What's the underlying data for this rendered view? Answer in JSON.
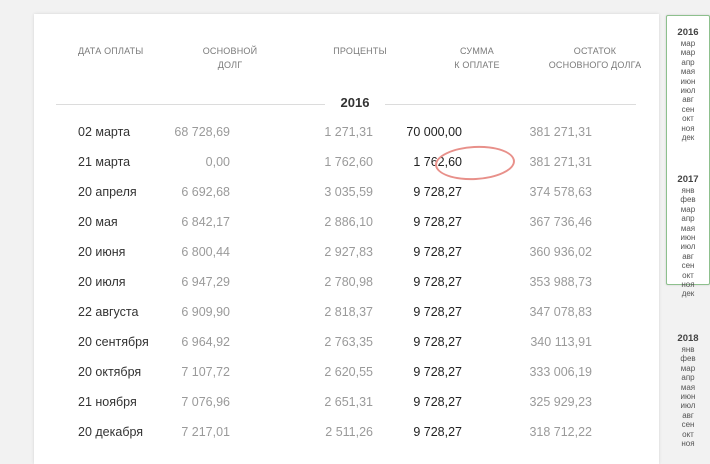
{
  "headers": {
    "date": [
      "ДАТА ОПЛАТЫ"
    ],
    "principal": [
      "ОСНОВНОЙ",
      "ДОЛГ"
    ],
    "interest": [
      "ПРОЦЕНТЫ"
    ],
    "total": [
      "СУММА",
      "К ОПЛАТЕ"
    ],
    "balance": [
      "ОСТАТОК",
      "ОСНОВНОГО ДОЛГА"
    ]
  },
  "year_label": "2016",
  "rows": [
    {
      "date": "02 марта",
      "principal": "68 728,69",
      "interest": "1 271,31",
      "total": "70 000,00",
      "balance": "381 271,31"
    },
    {
      "date": "21 марта",
      "principal": "0,00",
      "interest": "1 762,60",
      "total": "1 762,60",
      "balance": "381 271,31"
    },
    {
      "date": "20 апреля",
      "principal": "6 692,68",
      "interest": "3 035,59",
      "total": "9 728,27",
      "balance": "374 578,63"
    },
    {
      "date": "20 мая",
      "principal": "6 842,17",
      "interest": "2 886,10",
      "total": "9 728,27",
      "balance": "367 736,46"
    },
    {
      "date": "20 июня",
      "principal": "6 800,44",
      "interest": "2 927,83",
      "total": "9 728,27",
      "balance": "360 936,02"
    },
    {
      "date": "20 июля",
      "principal": "6 947,29",
      "interest": "2 780,98",
      "total": "9 728,27",
      "balance": "353 988,73"
    },
    {
      "date": "22 августа",
      "principal": "6 909,90",
      "interest": "2 818,37",
      "total": "9 728,27",
      "balance": "347 078,83"
    },
    {
      "date": "20 сентября",
      "principal": "6 964,92",
      "interest": "2 763,35",
      "total": "9 728,27",
      "balance": "340 113,91"
    },
    {
      "date": "20 октября",
      "principal": "7 107,72",
      "interest": "2 620,55",
      "total": "9 728,27",
      "balance": "333 006,19"
    },
    {
      "date": "21 ноября",
      "principal": "7 076,96",
      "interest": "2 651,31",
      "total": "9 728,27",
      "balance": "325 929,23"
    },
    {
      "date": "20 декабря",
      "principal": "7 217,01",
      "interest": "2 511,26",
      "total": "9 728,27",
      "balance": "318 712,22"
    }
  ],
  "sidebar": {
    "years": [
      {
        "year": "2016",
        "months": [
          "мар",
          "мар",
          "апр",
          "мая",
          "июн",
          "июл",
          "авг",
          "сен",
          "окт",
          "ноя",
          "дек"
        ]
      },
      {
        "year": "2017",
        "months": [
          "янв",
          "фев",
          "мар",
          "апр",
          "мая",
          "июн",
          "июл",
          "авг",
          "сен",
          "окт",
          "ноя",
          "дек"
        ]
      },
      {
        "year": "2018",
        "months": [
          "янв",
          "фев",
          "мар",
          "апр",
          "мая",
          "июн",
          "июл",
          "авг",
          "сен",
          "окт",
          "ноя"
        ]
      }
    ]
  },
  "colors": {
    "accent_border": "#8dc08d",
    "highlight_circle": "#e8908a"
  }
}
